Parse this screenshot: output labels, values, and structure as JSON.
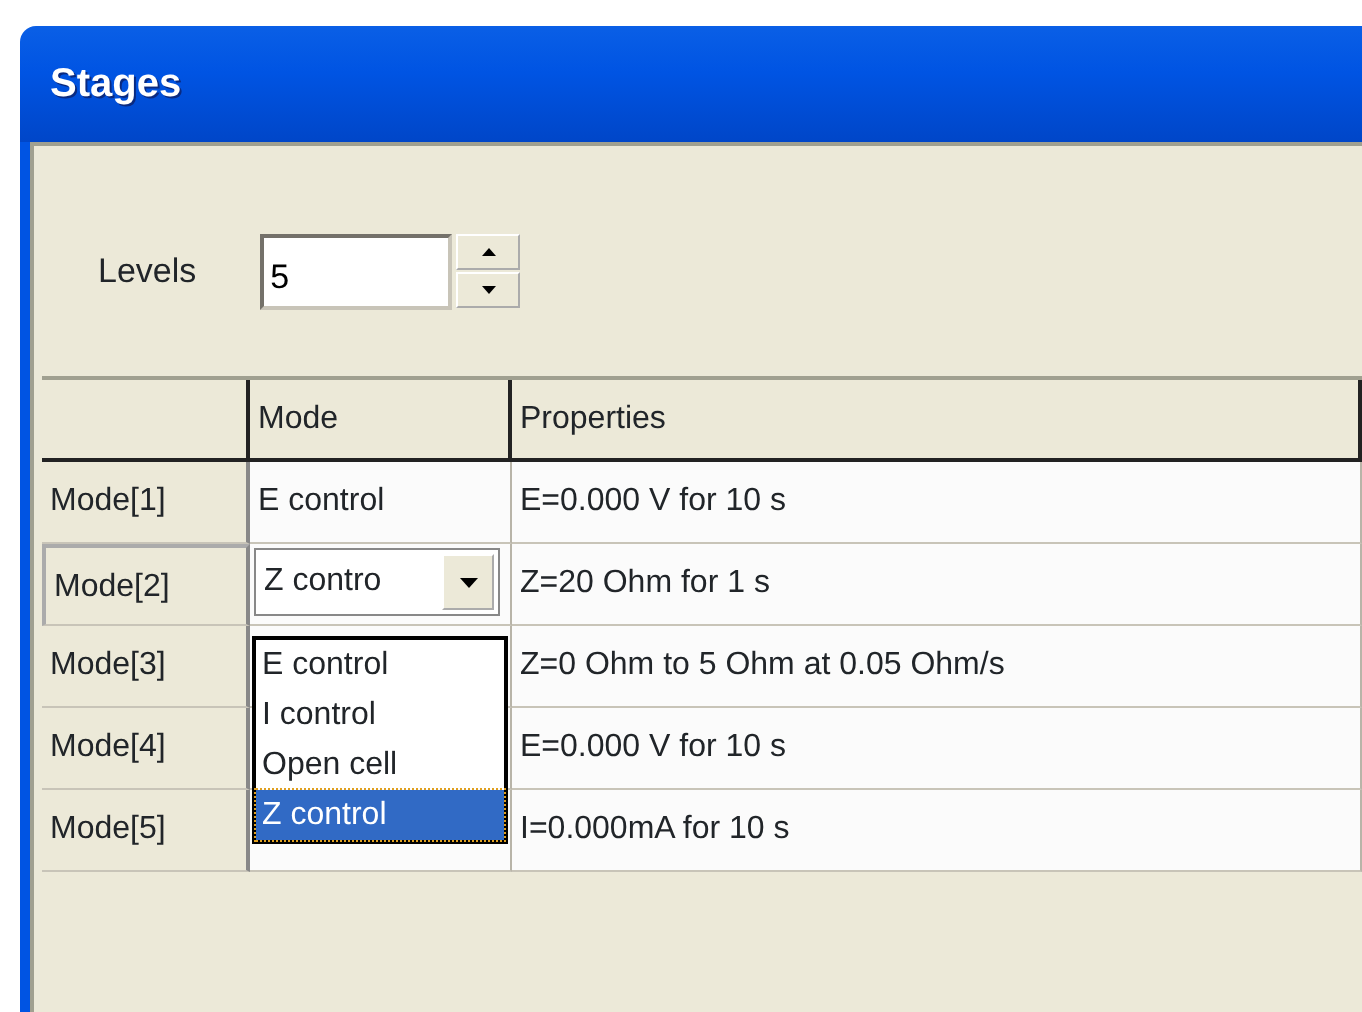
{
  "window": {
    "title": "Stages"
  },
  "levels": {
    "label": "Levels",
    "value": "5"
  },
  "table": {
    "columns": [
      "Mode",
      "Properties"
    ],
    "rows": [
      {
        "header": "Mode[1]",
        "selected": false,
        "mode": "E control",
        "properties": "E=0.000 V for 10 s"
      },
      {
        "header": "Mode[2]",
        "selected": true,
        "mode": "Z contro",
        "properties": "Z=20 Ohm for 1 s"
      },
      {
        "header": "Mode[3]",
        "selected": false,
        "properties": "Z=0 Ohm to 5 Ohm at 0.05 Ohm/s"
      },
      {
        "header": "Mode[4]",
        "selected": false,
        "properties": "E=0.000 V for 10 s"
      },
      {
        "header": "Mode[5]",
        "selected": false,
        "properties": "I=0.000mA for 10 s"
      }
    ]
  },
  "dropdown": {
    "options": [
      {
        "label": "E control",
        "selected": false
      },
      {
        "label": "I control",
        "selected": false
      },
      {
        "label": "Open cell",
        "selected": false
      },
      {
        "label": "Z control",
        "selected": true
      }
    ]
  }
}
